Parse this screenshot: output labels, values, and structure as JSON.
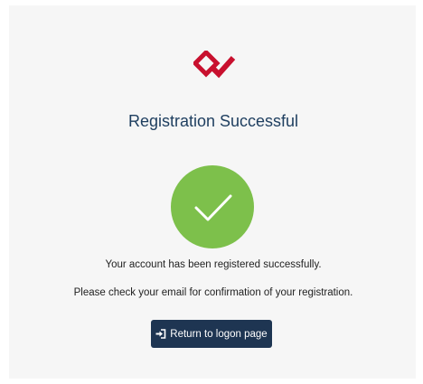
{
  "logo": {
    "icon": "brand-diamond-check-logo",
    "color": "#c8102e"
  },
  "title": "Registration Successful",
  "status": {
    "icon": "checkmark-icon",
    "color": "#7dc04b"
  },
  "messages": {
    "registered": "Your account has been registered successfully.",
    "check_email": "Please check your email for confirmation of your registration."
  },
  "button": {
    "icon": "sign-in-icon",
    "label": "Return to logon page",
    "color": "#1e3552"
  }
}
